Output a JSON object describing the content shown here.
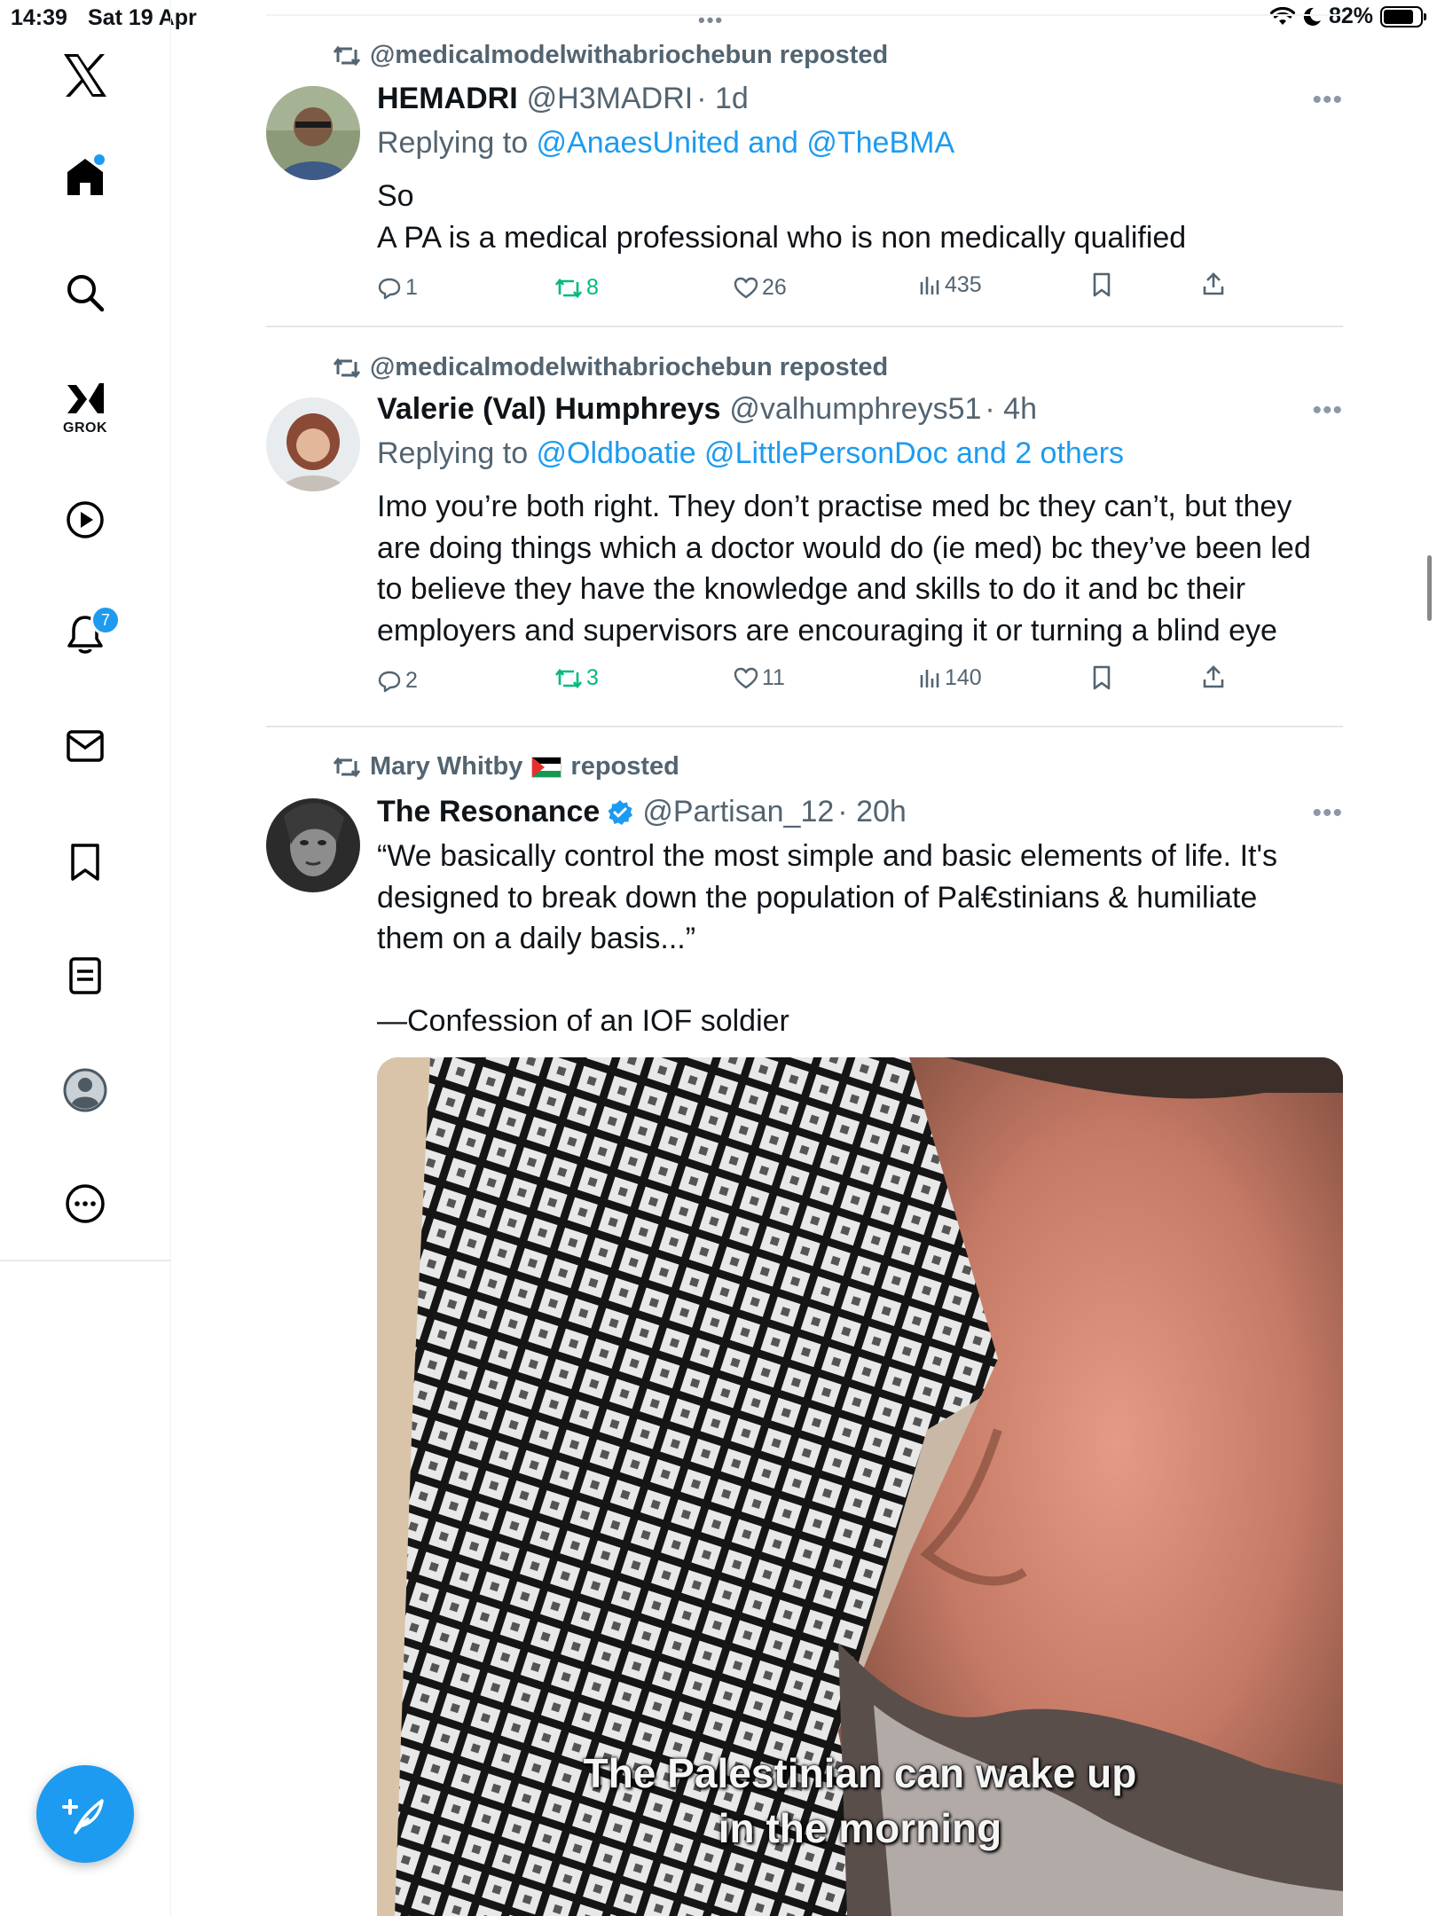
{
  "status_bar": {
    "time": "14:39",
    "date": "Sat 19 Apr",
    "battery": "82%",
    "battery_level": 0.82,
    "dots": "•••"
  },
  "sidebar": {
    "items": [
      {
        "icon": "x-logo-icon"
      },
      {
        "icon": "home-icon",
        "has_dot": true
      },
      {
        "icon": "search-icon"
      },
      {
        "icon": "grok-icon",
        "label": "GROK"
      },
      {
        "icon": "play-icon"
      },
      {
        "icon": "bell-icon",
        "badge": "7"
      },
      {
        "icon": "mail-icon"
      },
      {
        "icon": "bookmark-icon"
      },
      {
        "icon": "list-icon"
      },
      {
        "icon": "profile-icon"
      },
      {
        "icon": "more-circle-icon"
      }
    ],
    "compose_icon": "feather-plus-icon"
  },
  "colors": {
    "accent": "#1d9bf0",
    "secondary_text": "#536471",
    "retweet_green": "#00ba7c",
    "text": "#0f1419"
  },
  "tweets": [
    {
      "repost_by": "@medicalmodelwithabriochebun reposted",
      "name": "HEMADRI",
      "handle": "@H3MADRI",
      "time": "· 1d",
      "replying_prefix": "Replying to ",
      "replying_links": "@AnaesUnited and @TheBMA",
      "text": "So\nA PA is a medical professional who is non medically qualified",
      "stats": {
        "replies": "1",
        "reposts": "8",
        "likes": "26",
        "views": "435"
      },
      "more": "•••"
    },
    {
      "repost_by": "@medicalmodelwithabriochebun reposted",
      "name": "Valerie (Val) Humphreys",
      "handle": "@valhumphreys51",
      "time": "· 4h",
      "replying_prefix": "Replying to ",
      "replying_links": "@Oldboatie @LittlePersonDoc and 2 others",
      "text": "Imo you’re both right. They don’t practise med bc they can’t, but they are doing things which a doctor would do (ie med) bc they’ve been led to believe they have the knowledge and skills to do it and bc their employers and supervisors are encouraging it or turning a blind eye",
      "stats": {
        "replies": "2",
        "reposts": "3",
        "likes": "11",
        "views": "140"
      },
      "more": "•••"
    },
    {
      "repost_by": "Mary Whitby",
      "repost_suffix": "reposted",
      "repost_flag_icon": "palestine-flag-icon",
      "name": "The Resonance",
      "verified": true,
      "handle": "@Partisan_12",
      "time": "· 20h",
      "text": "“We basically control the most simple and basic elements of life. It's designed to break down the population of Pal€stinians & humiliate them on a daily basis...”\n\n—Confession of an IOF soldier",
      "media_caption_1": "The Palestinian can wake up",
      "media_caption_2": "in the morning",
      "more": "•••"
    }
  ]
}
